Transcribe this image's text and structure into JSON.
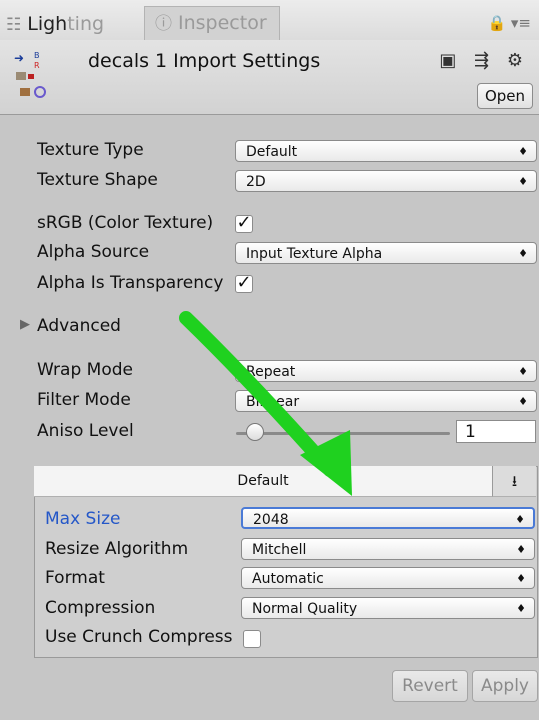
{
  "tabs": {
    "lighting_visible": "Ligh",
    "lighting_faded": "ting",
    "inspector": "Inspector"
  },
  "header": {
    "title": "decals 1 Import Settings",
    "open_label": "Open"
  },
  "settings": {
    "texture_type_label": "Texture Type",
    "texture_type_value": "Default",
    "texture_shape_label": "Texture Shape",
    "texture_shape_value": "2D",
    "srgb_label": "sRGB (Color Texture)",
    "srgb_checked": true,
    "alpha_source_label": "Alpha Source",
    "alpha_source_value": "Input Texture Alpha",
    "alpha_transparency_label": "Alpha Is Transparency",
    "alpha_transparency_checked": true,
    "advanced_label": "Advanced",
    "wrap_mode_label": "Wrap Mode",
    "wrap_mode_value": "Repeat",
    "filter_mode_label": "Filter Mode",
    "filter_mode_value": "Bilinear",
    "aniso_label": "Aniso Level",
    "aniso_value": "1"
  },
  "platform": {
    "tab_label": "Default",
    "max_size_label": "Max Size",
    "max_size_value": "2048",
    "resize_label": "Resize Algorithm",
    "resize_value": "Mitchell",
    "format_label": "Format",
    "format_value": "Automatic",
    "compression_label": "Compression",
    "compression_value": "Normal Quality",
    "crunch_label": "Use Crunch Compress",
    "crunch_checked": false
  },
  "footer": {
    "revert_label": "Revert",
    "apply_label": "Apply"
  },
  "colors": {
    "annotation_arrow": "#1fd11f",
    "focus_blue": "#4a7ad6"
  }
}
